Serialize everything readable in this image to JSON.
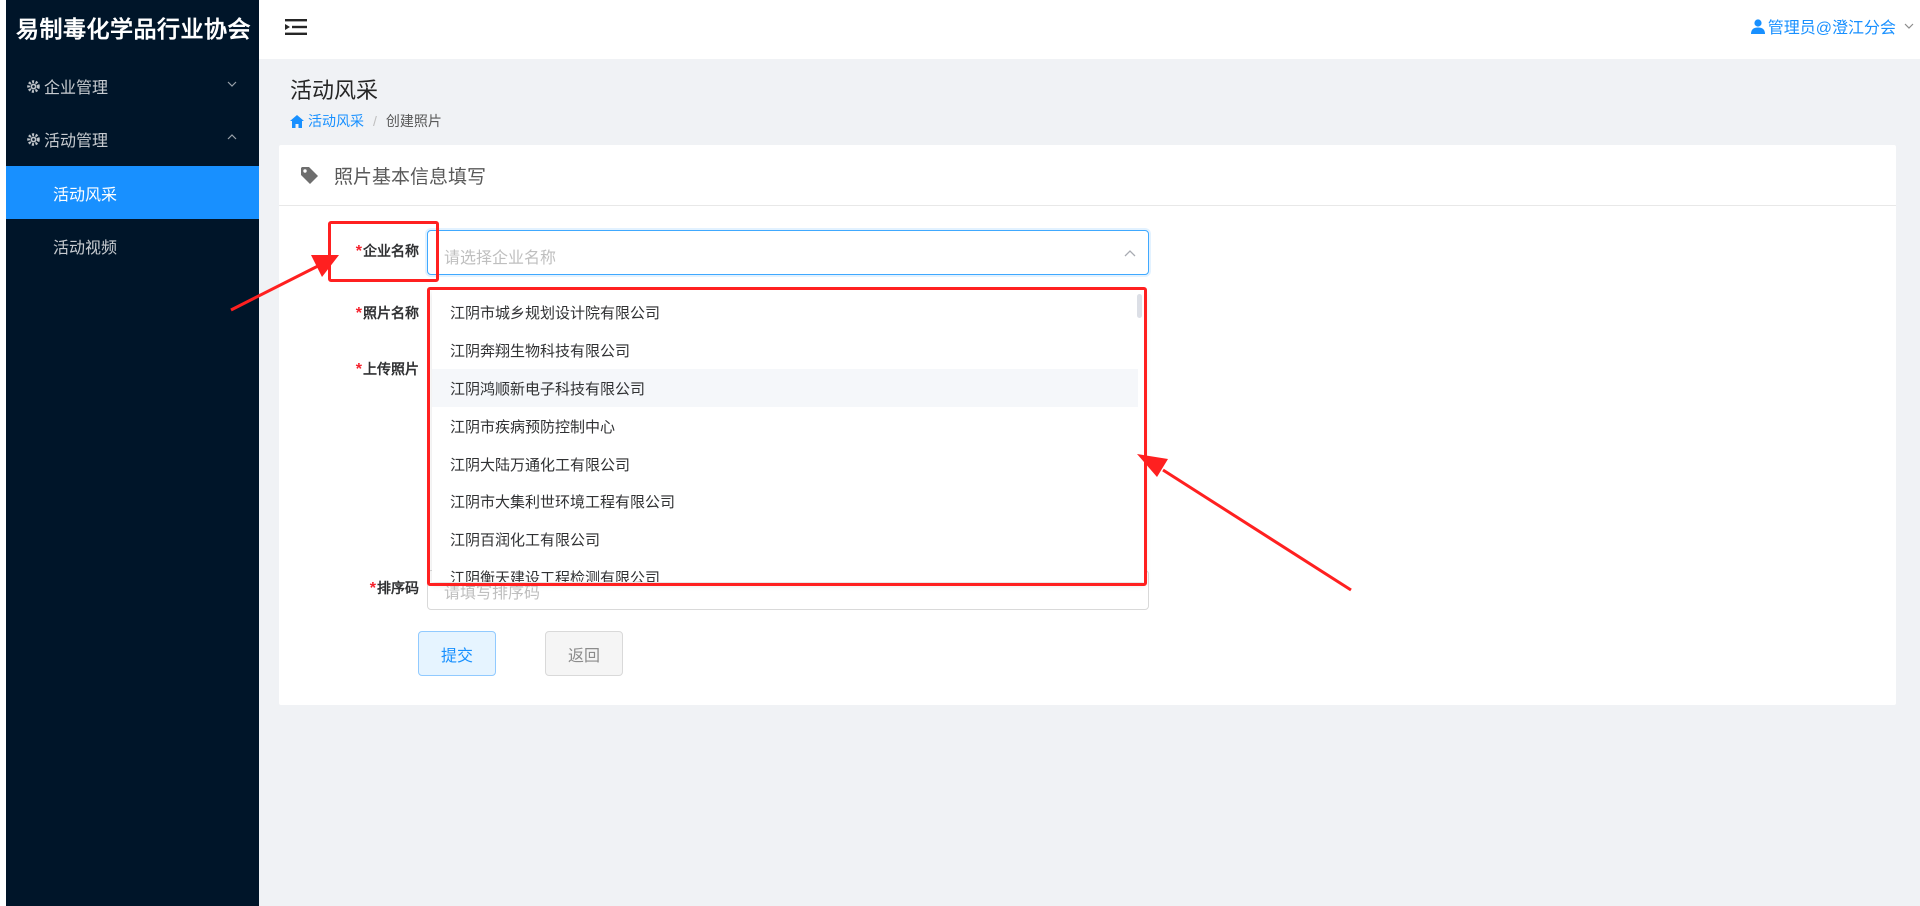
{
  "brand": {
    "title": "易制毒化学品行业协会"
  },
  "sidebar": {
    "groups": [
      {
        "label": "企业管理",
        "icon": "gear-icon",
        "expanded": false
      },
      {
        "label": "活动管理",
        "icon": "gear-icon",
        "expanded": true
      }
    ],
    "items": [
      {
        "label": "活动风采",
        "active": true
      },
      {
        "label": "活动视频",
        "active": false
      }
    ]
  },
  "header": {
    "menu_toggle_icon": "menu-fold-icon",
    "user": "管理员@澄江分会"
  },
  "page": {
    "title": "活动风采",
    "breadcrumb": {
      "home": "活动风采",
      "current": "创建照片"
    }
  },
  "card": {
    "title": "照片基本信息填写",
    "fields": {
      "company_label": "企业名称",
      "company_placeholder": "请选择企业名称",
      "photo_name_label": "照片名称",
      "upload_label": "上传照片",
      "sort_label": "排序码",
      "sort_placeholder": "请填写排序码"
    },
    "buttons": {
      "submit": "提交",
      "back": "返回"
    }
  },
  "dropdown": {
    "options": [
      "江阴市城乡规划设计院有限公司",
      "江阴奔翔生物科技有限公司",
      "江阴鸿顺新电子科技有限公司",
      "江阴市疾病预防控制中心",
      "江阴大陆万通化工有限公司",
      "江阴市大集利世环境工程有限公司",
      "江阴百润化工有限公司",
      "江阴衡天建设工程检测有限公司"
    ],
    "hovered_index": 2
  },
  "colors": {
    "sidebar_bg": "#001529",
    "accent": "#1890ff",
    "annotation": "#ff2020",
    "required": "#f5222d"
  }
}
